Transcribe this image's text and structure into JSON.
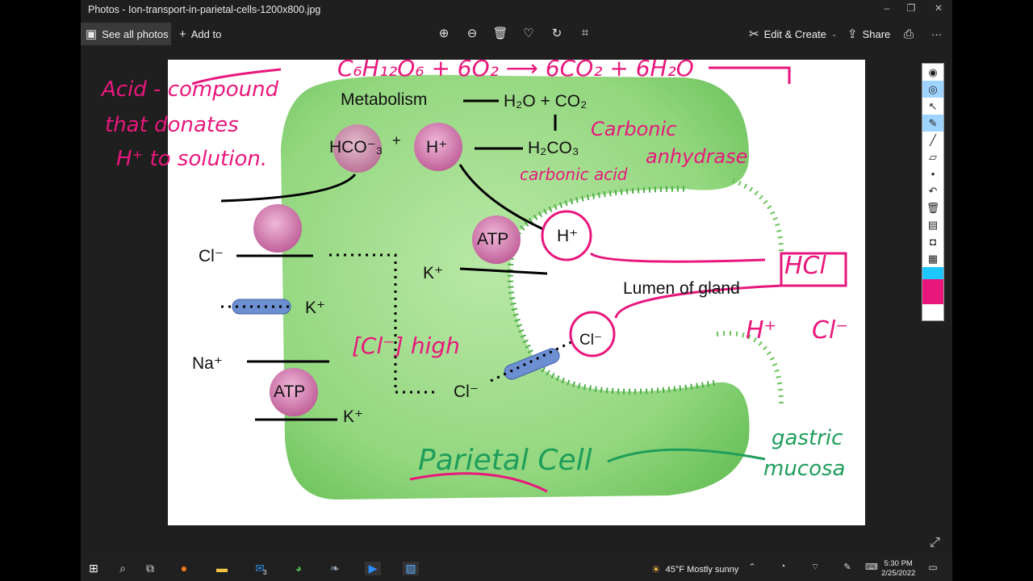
{
  "window": {
    "title": "Photos - Ion-transport-in-parietal-cells-1200x800.jpg",
    "minimize": "–",
    "restore": "❐",
    "close": "✕"
  },
  "toolbar": {
    "see_all_label": "See all photos",
    "add_to_label": "Add to",
    "edit_create_label": "Edit & Create",
    "share_label": "Share",
    "more_label": "···",
    "icons": [
      "zoom-in-icon",
      "zoom-out-icon",
      "delete-icon",
      "heart-icon",
      "rotate-icon",
      "crop-icon"
    ]
  },
  "diagram": {
    "metabolism": "Metabolism",
    "products": "H₂O + CO₂",
    "hco3": "HCO⁻₃",
    "plus": "+",
    "h_plus": "H⁺",
    "h2co3": "H₂CO₃",
    "atp_top": "ATP",
    "h_plus_lumen": "H⁺",
    "k_plus_in": "K⁺",
    "lumen_label": "Lumen of gland",
    "cl_left": "Cl⁻",
    "k_plus_channel": "K⁺",
    "na_plus": "Na⁺",
    "atp_bottom": "ATP",
    "k_plus_bottom": "K⁺",
    "cl_inner": "Cl⁻",
    "cl_lumen": "Cl⁻"
  },
  "annotations": {
    "equation": "C₆H₁₂O₆ + 6O₂ ⟶ 6CO₂ + 6H₂O",
    "acid_def_line1": "Acid - compound",
    "acid_def_line2": "that donates",
    "acid_def_line3": "H⁺ to solution.",
    "carbonic_anhydrase_1": "Carbonic",
    "carbonic_anhydrase_2": "anhydrase",
    "carbonic_acid": "carbonic acid",
    "hcl": "HCl",
    "h_ion": "H⁺",
    "cl_ion": "Cl⁻",
    "cl_high": "[Cl⁻] high",
    "parietal_cell": "Parietal Cell",
    "gastric_1": "gastric",
    "gastric_2": "mucosa"
  },
  "right_toolbar": [
    "pen-tip-icon",
    "eye-icon",
    "pointer-icon",
    "highlighter-icon",
    "line-icon",
    "eraser-icon",
    "dot-icon",
    "undo-icon",
    "trash-icon",
    "whiteboard-icon",
    "camera-icon",
    "clipboard-icon",
    "color-palette-icon"
  ],
  "colors": {
    "ink_pink": "#e8177c",
    "ink_green": "#1e9e5a",
    "cell_green": "#8fd47a"
  },
  "taskbar": {
    "weather": "45°F  Mostly sunny",
    "time": "5:30 PM",
    "date": "2/25/2022",
    "mail_badge": "3"
  }
}
